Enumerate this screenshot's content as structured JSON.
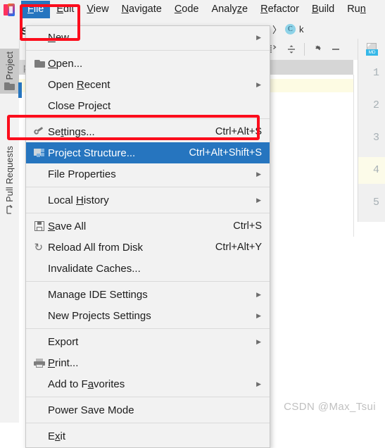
{
  "app": {
    "logo_icon": "intellij-idea-logo-icon",
    "project_label_partial": "Spr"
  },
  "menubar": {
    "items": [
      {
        "label": "File",
        "mnemonic": "F",
        "active": true
      },
      {
        "label": "Edit",
        "mnemonic": "E",
        "active": false
      },
      {
        "label": "View",
        "mnemonic": "V",
        "active": false
      },
      {
        "label": "Navigate",
        "mnemonic": "N",
        "active": false
      },
      {
        "label": "Code",
        "mnemonic": "C",
        "active": false
      },
      {
        "label": "Analyze",
        "mnemonic": "z",
        "active": false
      },
      {
        "label": "Refactor",
        "mnemonic": "R",
        "active": false
      },
      {
        "label": "Build",
        "mnemonic": "B",
        "active": false
      },
      {
        "label": "Run",
        "mnemonic": "n",
        "active": false
      }
    ]
  },
  "breadcrumb": {
    "separator": "〉",
    "class_badge": "C",
    "trailing_text": "k"
  },
  "toolstrip": {
    "icons": [
      "expand-all-icon",
      "collapse-all-icon",
      "settings-gear-icon",
      "hide-panel-icon"
    ],
    "file_tab_icon": "markdown-file-icon",
    "file_tab_label": "MD"
  },
  "leftbar": {
    "items": [
      {
        "label": "Project",
        "icon": "folder-icon",
        "selected": true
      },
      {
        "label": "Pull Requests",
        "icon": "pull-request-icon",
        "selected": false
      }
    ]
  },
  "project_panel": {
    "tab_label": "pringboot_demo"
  },
  "editor": {
    "line_numbers": [
      "1",
      "2",
      "3",
      "4",
      "5"
    ],
    "highlighted_line": "4"
  },
  "file_menu": {
    "items": [
      {
        "label": "New",
        "mnemonic": "N",
        "icon": "",
        "accel": "",
        "arrow": true,
        "selected": false
      },
      {
        "type": "separator"
      },
      {
        "label": "Open...",
        "mnemonic": "O",
        "icon": "folder-open-icon",
        "accel": "",
        "arrow": false,
        "selected": false
      },
      {
        "label": "Open Recent",
        "mnemonic": "R",
        "icon": "",
        "accel": "",
        "arrow": true,
        "selected": false
      },
      {
        "label": "Close Project",
        "mnemonic": "",
        "icon": "",
        "accel": "",
        "arrow": false,
        "selected": false
      },
      {
        "type": "separator"
      },
      {
        "label": "Settings...",
        "mnemonic": "t",
        "icon": "wrench-icon",
        "accel": "Ctrl+Alt+S",
        "arrow": false,
        "selected": false
      },
      {
        "label": "Project Structure...",
        "mnemonic": "",
        "icon": "project-structure-icon",
        "accel": "Ctrl+Alt+Shift+S",
        "arrow": false,
        "selected": true
      },
      {
        "label": "File Properties",
        "mnemonic": "",
        "icon": "",
        "accel": "",
        "arrow": true,
        "selected": false
      },
      {
        "type": "separator"
      },
      {
        "label": "Local History",
        "mnemonic": "H",
        "icon": "",
        "accel": "",
        "arrow": true,
        "selected": false
      },
      {
        "type": "separator"
      },
      {
        "label": "Save All",
        "mnemonic": "S",
        "icon": "save-icon",
        "accel": "Ctrl+S",
        "arrow": false,
        "selected": false
      },
      {
        "label": "Reload All from Disk",
        "mnemonic": "",
        "icon": "reload-icon",
        "accel": "Ctrl+Alt+Y",
        "arrow": false,
        "selected": false
      },
      {
        "label": "Invalidate Caches...",
        "mnemonic": "",
        "icon": "",
        "accel": "",
        "arrow": false,
        "selected": false
      },
      {
        "type": "separator"
      },
      {
        "label": "Manage IDE Settings",
        "mnemonic": "",
        "icon": "",
        "accel": "",
        "arrow": true,
        "selected": false
      },
      {
        "label": "New Projects Settings",
        "mnemonic": "",
        "icon": "",
        "accel": "",
        "arrow": true,
        "selected": false
      },
      {
        "type": "separator"
      },
      {
        "label": "Export",
        "mnemonic": "",
        "icon": "",
        "accel": "",
        "arrow": true,
        "selected": false
      },
      {
        "label": "Print...",
        "mnemonic": "P",
        "icon": "print-icon",
        "accel": "",
        "arrow": false,
        "selected": false
      },
      {
        "label": "Add to Favorites",
        "mnemonic": "a",
        "icon": "",
        "accel": "",
        "arrow": true,
        "selected": false
      },
      {
        "type": "separator"
      },
      {
        "label": "Power Save Mode",
        "mnemonic": "",
        "icon": "",
        "accel": "",
        "arrow": false,
        "selected": false
      },
      {
        "type": "separator"
      },
      {
        "label": "Exit",
        "mnemonic": "x",
        "icon": "",
        "accel": "",
        "arrow": false,
        "selected": false
      }
    ]
  },
  "annotations": {
    "color": "#fc0d1c",
    "boxes": [
      "file-menu-button-highlight",
      "project-structure-item-highlight"
    ]
  },
  "watermark": {
    "text": "CSDN @Max_Tsui"
  }
}
